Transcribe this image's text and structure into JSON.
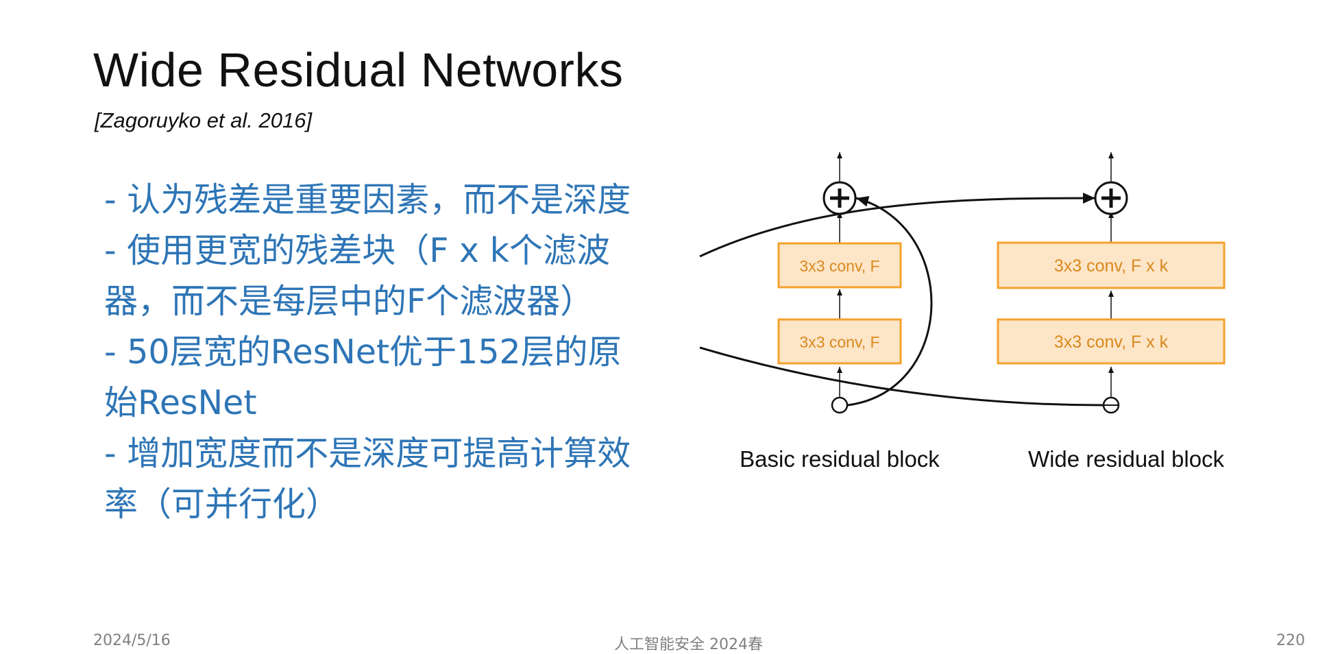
{
  "slide": {
    "title": "Wide Residual Networks",
    "citation": "[Zagoruyko et al. 2016]",
    "bullets": [
      "- 认为残差是重要因素，而不是深度",
      "- 使用更宽的残差块（F x k个滤波器，而不是每层中的F个滤波器）",
      "- 50层宽的ResNet优于152层的原始ResNet",
      "- 增加宽度而不是深度可提高计算效率（可并行化）"
    ]
  },
  "diagram": {
    "basic_block": {
      "layer_top": "3x3 conv, F",
      "layer_bottom": "3x3 conv, F",
      "caption": "Basic residual block"
    },
    "wide_block": {
      "layer_top": "3x3 conv, F x k",
      "layer_bottom": "3x3 conv, F x k",
      "caption": "Wide residual block"
    },
    "colors": {
      "box_fill": "#fde5c7",
      "box_stroke": "#f4a12b",
      "box_text": "#d9891f",
      "line": "#111111"
    }
  },
  "footer": {
    "date": "2024/5/16",
    "course": "人工智能安全 2024春",
    "page": "220"
  }
}
